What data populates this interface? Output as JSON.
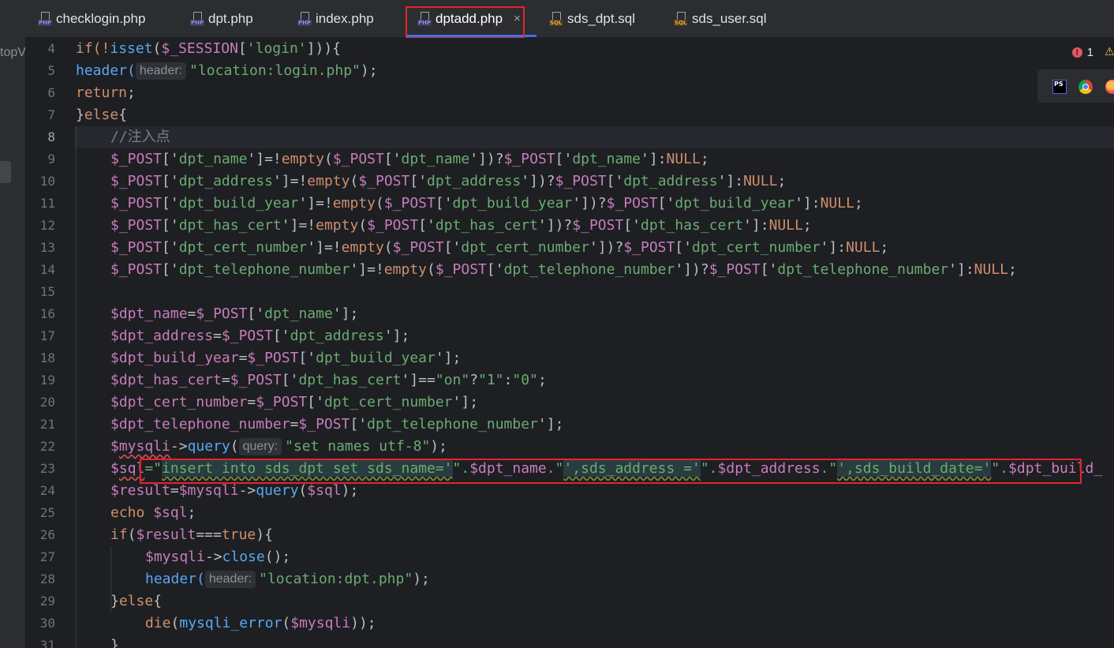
{
  "left_strip": {
    "project_label": "topV"
  },
  "tabs": [
    {
      "label": "checklogin.php",
      "type": "PHP"
    },
    {
      "label": "dpt.php",
      "type": "PHP"
    },
    {
      "label": "index.php",
      "type": "PHP"
    },
    {
      "label": "dptadd.php",
      "type": "PHP",
      "active": true,
      "close": "×"
    },
    {
      "label": "sds_dpt.sql",
      "type": "SQL"
    },
    {
      "label": "sds_user.sql",
      "type": "SQL"
    }
  ],
  "inspection": {
    "error_count": "1",
    "error_glyph": "!",
    "warning_glyph": "⚠"
  },
  "browsers": [
    {
      "name": "phpstorm-icon",
      "text": "PS"
    },
    {
      "name": "chrome-icon"
    },
    {
      "name": "firefox-icon"
    }
  ],
  "editor": {
    "line_numbers": [
      "4",
      "5",
      "6",
      "7",
      "8",
      "9",
      "10",
      "11",
      "12",
      "13",
      "14",
      "15",
      "16",
      "17",
      "18",
      "19",
      "20",
      "21",
      "22",
      "23",
      "24",
      "25",
      "26",
      "27",
      "28",
      "29",
      "30",
      "31"
    ],
    "current_line": "8",
    "hints": {
      "header": "header:",
      "query": "query:"
    },
    "lines": {
      "l4": {
        "a": "if(!",
        "b": "isset",
        "c": "(",
        "d": "$_SESSION",
        "e": "[",
        "f": "'login'",
        "g": "])){"
      },
      "l5": {
        "a": "header(",
        "b": "\"location:login.php\"",
        "c": ");"
      },
      "l6": {
        "a": "return",
        "b": ";"
      },
      "l7": {
        "a": "}",
        "b": "else",
        "c": "{"
      },
      "l8": {
        "a": "//注入点"
      },
      "l9": {
        "a": "$_POST",
        "b": "['",
        "c": "dpt_name",
        "d": "']=!",
        "e": "empty",
        "f": "(",
        "g": "$_POST",
        "h": "['",
        "i": "dpt_name",
        "j": "'])?",
        "k": "$_POST",
        "l": "['",
        "m": "dpt_name",
        "n": "']:",
        "o": "NULL",
        "p": ";"
      },
      "l10": {
        "a": "$_POST",
        "b": "['",
        "c": "dpt_address",
        "d": "']=!",
        "e": "empty",
        "f": "(",
        "g": "$_POST",
        "h": "['",
        "i": "dpt_address",
        "j": "'])?",
        "k": "$_POST",
        "l": "['",
        "m": "dpt_address",
        "n": "']:",
        "o": "NULL",
        "p": ";"
      },
      "l11": {
        "a": "$_POST",
        "b": "['",
        "c": "dpt_build_year",
        "d": "']=!",
        "e": "empty",
        "f": "(",
        "g": "$_POST",
        "h": "['",
        "i": "dpt_build_year",
        "j": "'])?",
        "k": "$_POST",
        "l": "['",
        "m": "dpt_build_year",
        "n": "']:",
        "o": "NULL",
        "p": ";"
      },
      "l12": {
        "a": "$_POST",
        "b": "['",
        "c": "dpt_has_cert",
        "d": "']=!",
        "e": "empty",
        "f": "(",
        "g": "$_POST",
        "h": "['",
        "i": "dpt_has_cert",
        "j": "'])?",
        "k": "$_POST",
        "l": "['",
        "m": "dpt_has_cert",
        "n": "']:",
        "o": "NULL",
        "p": ";"
      },
      "l13": {
        "a": "$_POST",
        "b": "['",
        "c": "dpt_cert_number",
        "d": "']=!",
        "e": "empty",
        "f": "(",
        "g": "$_POST",
        "h": "['",
        "i": "dpt_cert_number",
        "j": "'])?",
        "k": "$_POST",
        "l": "['",
        "m": "dpt_cert_number",
        "n": "']:",
        "o": "NULL",
        "p": ";"
      },
      "l14": {
        "a": "$_POST",
        "b": "['",
        "c": "dpt_telephone_number",
        "d": "']=!",
        "e": "empty",
        "f": "(",
        "g": "$_POST",
        "h": "['",
        "i": "dpt_telephone_number",
        "j": "'])?",
        "k": "$_POST",
        "l": "['",
        "m": "dpt_telephone_number",
        "n": "']:",
        "o": "NULL",
        "p": ";"
      },
      "l16": {
        "a": "$dpt_name",
        "b": "=",
        "c": "$_POST",
        "d": "['",
        "e": "dpt_name",
        "f": "'];"
      },
      "l17": {
        "a": "$dpt_address",
        "b": "=",
        "c": "$_POST",
        "d": "['",
        "e": "dpt_address",
        "f": "'];"
      },
      "l18": {
        "a": "$dpt_build_year",
        "b": "=",
        "c": "$_POST",
        "d": "['",
        "e": "dpt_build_year",
        "f": "'];"
      },
      "l19": {
        "a": "$dpt_has_cert",
        "b": "=",
        "c": "$_POST",
        "d": "['",
        "e": "dpt_has_cert",
        "f": "']==",
        "g": "\"on\"",
        "h": "?",
        "i": "\"1\"",
        "j": ":",
        "k": "\"0\"",
        "l": ";"
      },
      "l20": {
        "a": "$dpt_cert_number",
        "b": "=",
        "c": "$_POST",
        "d": "['",
        "e": "dpt_cert_number",
        "f": "'];"
      },
      "l21": {
        "a": "$dpt_telephone_number",
        "b": "=",
        "c": "$_POST",
        "d": "['",
        "e": "dpt_telephone_number",
        "f": "'];"
      },
      "l22": {
        "a": "$",
        "b": "mysqli",
        "c": "->",
        "d": "query",
        "e": "(",
        "f": "\"set names utf-8\"",
        "g": ");"
      },
      "l23": {
        "a": "$",
        "b": "sql",
        "c": "=\"",
        "d": "insert into sds_dpt set sds_name='",
        "e": "\".",
        "f": "$dpt_name",
        "g": ".\"",
        "h": "',sds_address ='",
        "i": "\".",
        "j": "$dpt_address",
        "k": ".\"",
        "l": "',sds_build_date='",
        "m": "\".",
        "n": "$dpt_build_"
      },
      "l24": {
        "a": "$result",
        "b": "=",
        "c": "$mysqli",
        "d": "->",
        "e": "query",
        "f": "(",
        "g": "$sql",
        "h": ");"
      },
      "l25": {
        "a": "echo ",
        "b": "$sql",
        "c": ";"
      },
      "l26": {
        "a": "if",
        "b": "(",
        "c": "$result",
        "d": "===",
        "e": "true",
        "f": "){"
      },
      "l27": {
        "a": "$mysqli",
        "b": "->",
        "c": "close",
        "d": "();"
      },
      "l28": {
        "a": "header(",
        "b": "\"location:dpt.php\"",
        "c": ");"
      },
      "l29": {
        "a": "}",
        "b": "else",
        "c": "{"
      },
      "l30": {
        "a": "die",
        "b": "(",
        "c": "mysqli_error",
        "d": "(",
        "e": "$mysqli",
        "f": "));"
      },
      "l31": {
        "a": "}"
      }
    }
  }
}
